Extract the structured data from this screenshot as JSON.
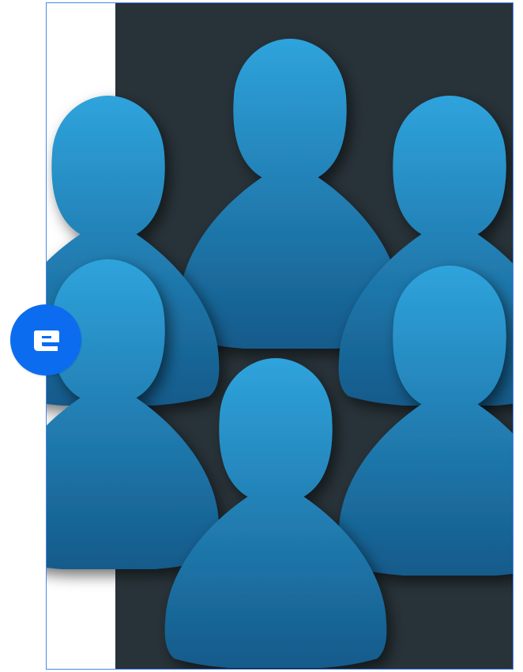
{
  "image": {
    "subject": "group-of-people-icons",
    "figure_count": 6
  },
  "controls": {
    "edit_button": {
      "icon": "letter-e-icon",
      "color": "#0b6cf0"
    }
  },
  "colors": {
    "background_dark": "#283339",
    "figure_top": "#2fa3dc",
    "figure_bottom": "#145a8a",
    "frame_border": "#4a86e8"
  }
}
